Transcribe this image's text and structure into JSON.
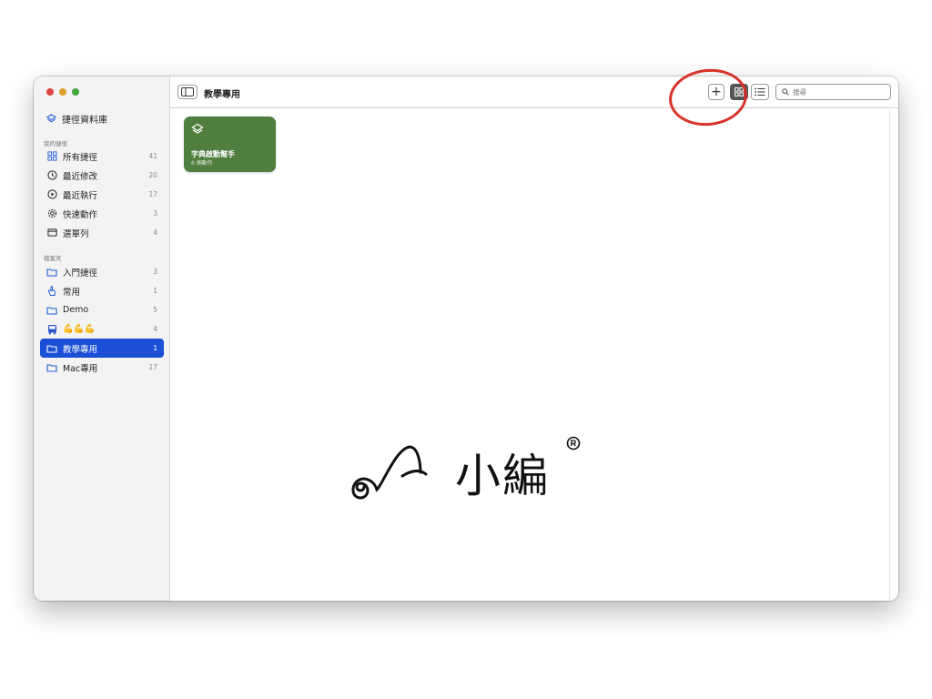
{
  "library": {
    "label": "捷徑資料庫"
  },
  "sections": {
    "my_shortcuts": "我的捷徑",
    "folders": "檔案夾"
  },
  "my_shortcuts": [
    {
      "label": "所有捷徑",
      "count": "41",
      "icon": "grid-icon"
    },
    {
      "label": "最近修改",
      "count": "20",
      "icon": "clock-icon"
    },
    {
      "label": "最近執行",
      "count": "17",
      "icon": "play-circle-icon"
    },
    {
      "label": "快速動作",
      "count": "3",
      "icon": "gear-icon"
    },
    {
      "label": "選單列",
      "count": "4",
      "icon": "menubar-icon"
    }
  ],
  "folders": [
    {
      "label": "入門捷徑",
      "count": "3",
      "icon": "folder-icon"
    },
    {
      "label": "常用",
      "count": "1",
      "icon": "hand-pointer-icon"
    },
    {
      "label": "Demo",
      "count": "5",
      "icon": "folder-icon"
    },
    {
      "label": "💪💪💪",
      "count": "4",
      "icon": "bus-icon"
    },
    {
      "label": "教學專用",
      "count": "1",
      "icon": "folder-icon",
      "selected": true
    },
    {
      "label": "Mac專用",
      "count": "17",
      "icon": "folder-icon"
    }
  ],
  "toolbar": {
    "title": "教學專用",
    "add_label": "+",
    "search_placeholder": "搜尋"
  },
  "shortcut_card": {
    "name": "字典啟動幫手",
    "subtitle": "6 個動作",
    "color": "#4f7e3e",
    "icon": "shortcuts-layers-icon"
  },
  "watermark": {
    "text": "小編"
  },
  "colors": {
    "accent": "#1a4fd6",
    "annotation": "#d8322b"
  }
}
